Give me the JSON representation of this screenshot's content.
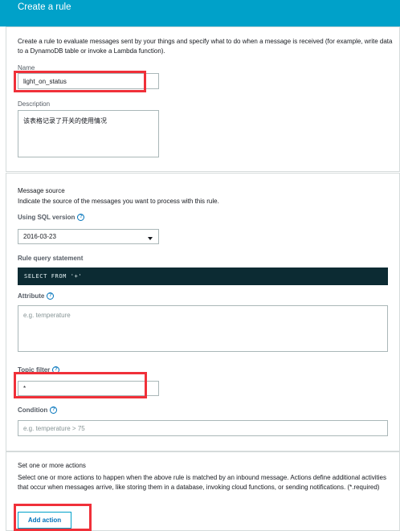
{
  "header": {
    "title": "Create a rule"
  },
  "rule": {
    "intro": "Create a rule to evaluate messages sent by your things and specify what to do when a message is received (for example, write data to a DynamoDB table or invoke a Lambda function).",
    "name_label": "Name",
    "name_value": "light_on_status",
    "description_label": "Description",
    "description_value": "该表格记录了开关的使用情况"
  },
  "message_source": {
    "title": "Message source",
    "subtitle": "Indicate the source of the messages you want to process with this rule.",
    "sql_version_label": "Using SQL version",
    "sql_version_value": "2016-03-23",
    "query_label": "Rule query statement",
    "query_value": "SELECT FROM '+'",
    "attribute_label": "Attribute",
    "attribute_placeholder": "e.g. temperature",
    "topic_filter_label": "Topic filter",
    "topic_filter_value": "*",
    "condition_label": "Condition",
    "condition_placeholder": "e.g. temperature > 75"
  },
  "actions": {
    "title": "Set one or more actions",
    "description": "Select one or more actions to happen when the above rule is matched by an inbound message. Actions define additional activities that occur when messages arrive, like storing them in a database, invoking cloud functions, or sending notifications. (*.required)",
    "add_action_label": "Add action"
  },
  "icons": {
    "help": "help-circle-icon",
    "dropdown": "chevron-down-icon"
  },
  "colors": {
    "header": "#00a1c9",
    "highlight": "#f03039",
    "code_bg": "#0c2b33",
    "link": "#0073bb"
  }
}
